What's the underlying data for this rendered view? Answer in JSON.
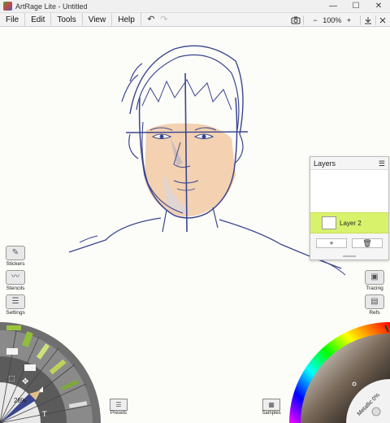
{
  "window": {
    "title": "ArtRage Lite - Untitled",
    "minimize": "—",
    "maximize": "☐",
    "close": "✕"
  },
  "menu": {
    "items": [
      "File",
      "Edit",
      "Tools",
      "View",
      "Help"
    ],
    "undo": "↶",
    "redo": "↷"
  },
  "zoom": {
    "minus": "−",
    "value": "100%",
    "plus": "+"
  },
  "toolbar_icons": [
    "camera-icon",
    "download-icon",
    "close-canvas-icon"
  ],
  "layers_panel": {
    "title": "Layers",
    "menu_icon": "☰",
    "layer_name": "Layer 2",
    "add_label": "+",
    "delete_label": "🗑"
  },
  "left_panel": {
    "stickers": "Stickers",
    "stencils": "Stencils",
    "settings": "Settings"
  },
  "right_panel": {
    "tracing": "Tracing",
    "refs": "Refs"
  },
  "bottom": {
    "brush_size": "28%",
    "presets": "Presets",
    "samples": "Samples",
    "metallic": "Metallic 0%"
  },
  "colors": {
    "accent": "#d9f26b",
    "stroke": "#3a4690",
    "skin": "#f1c9a5"
  }
}
